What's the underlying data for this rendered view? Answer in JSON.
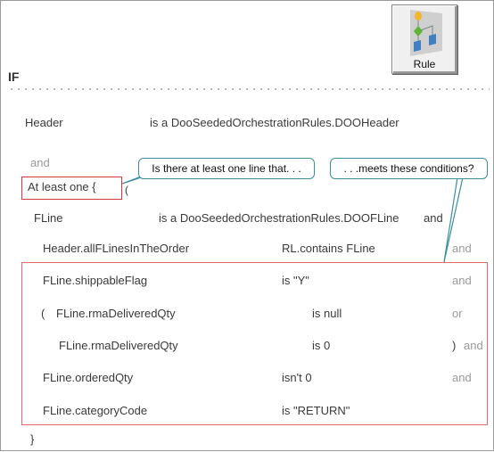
{
  "toolbar": {
    "rule_button": {
      "label": "Rule",
      "icon": "rule-flowchart-icon"
    }
  },
  "section": {
    "label": "IF"
  },
  "rows": {
    "header": {
      "name": "Header",
      "type": "is a  DooSeededOrchestrationRules.DOOHeader"
    },
    "and1": "and",
    "at_least_one": "At least one  {",
    "open_brace": "(",
    "fline": {
      "name": "FLine",
      "type": "is a  DooSeededOrchestrationRules.DOOFLine",
      "conj": "and"
    },
    "conditions": [
      {
        "left": "Header.allFLinesInTheOrder",
        "op": "RL.contains  FLine",
        "conj": "and"
      },
      {
        "left": "FLine.shippableFlag",
        "op": "is  \"Y\"",
        "conj": "and"
      },
      {
        "prefix": "(",
        "left": "FLine.rmaDeliveredQty",
        "op": "is  null",
        "conj": "or"
      },
      {
        "left": "FLine.rmaDeliveredQty",
        "op": "is  0",
        "suffix": ")",
        "conj": "and"
      },
      {
        "left": "FLine.orderedQty",
        "op": "isn't  0",
        "conj": "and"
      },
      {
        "left": "FLine.categoryCode",
        "op": "is  \"RETURN\"",
        "conj": ""
      }
    ],
    "close_brace": "}"
  },
  "callouts": {
    "left": "Is there at least one line that. . .",
    "right": ". . .meets these conditions?"
  },
  "colors": {
    "highlight_box": "#d23a3a",
    "callout_border": "#3a8f9a",
    "keyword_gray": "#9a9a9a"
  }
}
